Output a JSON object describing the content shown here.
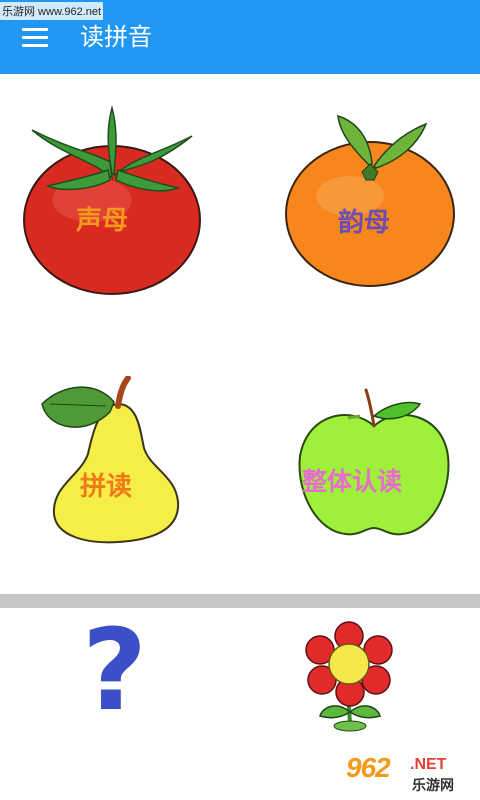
{
  "app": {
    "title": "读拼音",
    "menu_icon": "hamburger-icon",
    "accent_color": "#2196f3"
  },
  "watermark": {
    "top_text": "乐游网 www.962.net",
    "logo_number": "962",
    "logo_suffix": ".NET",
    "logo_cn": "乐游网"
  },
  "grid": {
    "items": [
      {
        "label": "声母",
        "icon": "tomato-icon",
        "label_color": "#f39a1b"
      },
      {
        "label": "韵母",
        "icon": "orange-icon",
        "label_color": "#6a4fb0"
      },
      {
        "label": "拼读",
        "icon": "pear-icon",
        "label_color": "#f07a1a"
      },
      {
        "label": "整体认读",
        "icon": "apple-icon",
        "label_color": "#e86bd0"
      }
    ]
  },
  "bottom": {
    "help_symbol": "?",
    "help_icon": "question-mark-icon",
    "flower_icon": "flower-icon"
  }
}
